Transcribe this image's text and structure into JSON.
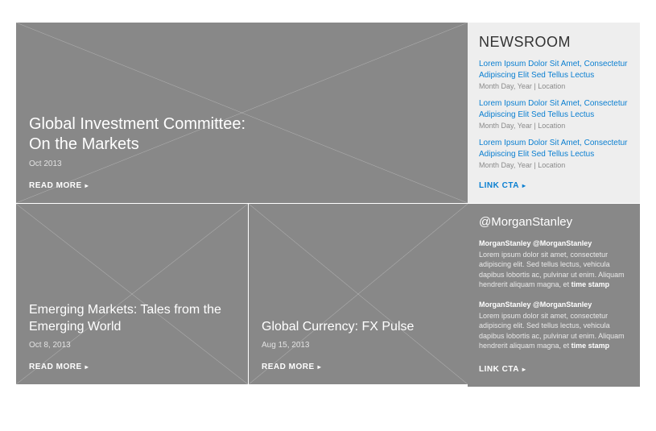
{
  "hero": {
    "title": "Global Investment Committee:\nOn the Markets",
    "date": "Oct 2013",
    "cta": "READ MORE"
  },
  "cards": [
    {
      "title": "Emerging Markets: Tales from the Emerging World",
      "date": "Oct 8, 2013",
      "cta": "READ MORE"
    },
    {
      "title": "Global Currency: FX Pulse",
      "date": "Aug 15, 2013",
      "cta": "READ MORE"
    }
  ],
  "newsroom": {
    "heading": "NEWSROOM",
    "items": [
      {
        "link": "Lorem Ipsum Dolor Sit Amet, Consectetur Adipiscing Elit Sed Tellus Lectus",
        "meta": "Month Day, Year  |  Location"
      },
      {
        "link": "Lorem Ipsum Dolor Sit Amet, Consectetur Adipiscing Elit Sed Tellus Lectus",
        "meta": "Month Day, Year  |  Location"
      },
      {
        "link": "Lorem Ipsum Dolor Sit Amet, Consectetur Adipiscing Elit Sed Tellus Lectus",
        "meta": "Month Day, Year  |  Location"
      }
    ],
    "cta": "LINK CTA"
  },
  "twitter": {
    "handle": "@MorganStanley",
    "tweets": [
      {
        "author": "MorganStanley @MorganStanley",
        "body": "Lorem ipsum dolor sit amet, consectetur adipiscing elit. Sed tellus lectus, vehicula dapibus lobortis ac, pulvinar ut enim. Aliquam hendrerit aliquam magna, et ",
        "stamp": "time stamp"
      },
      {
        "author": "MorganStanley @MorganStanley",
        "body": "Lorem ipsum dolor sit amet, consectetur adipiscing elit. Sed tellus lectus, vehicula dapibus lobortis ac, pulvinar ut enim. Aliquam hendrerit aliquam magna, et ",
        "stamp": "time stamp"
      }
    ],
    "cta": "LINK CTA"
  },
  "glyphs": {
    "arrow": "▸"
  }
}
